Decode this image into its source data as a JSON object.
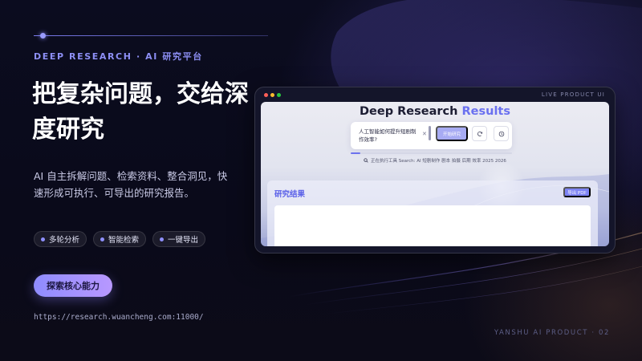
{
  "hero": {
    "eyebrow": "DEEP RESEARCH · AI 研究平台",
    "headline": "把复杂问题，交给深度研究",
    "description": "AI 自主拆解问题、检索资料、整合洞见，快速形成可执行、可导出的研究报告。",
    "chips": [
      "多轮分析",
      "智能检索",
      "一键导出"
    ],
    "cta_label": "探索核心能力",
    "url": "https://research.wuancheng.com:11000/"
  },
  "footer": {
    "text": "YANSHU AI PRODUCT · 02"
  },
  "window": {
    "tag": "LIVE PRODUCT UI",
    "app": {
      "title_main": "Deep Research",
      "title_accent": "Results",
      "query": "人工智能如何提升短剧制作效率?",
      "start_label": "开始研究",
      "progress": 0.06,
      "status": "正在执行工具 Search: AI 短剧制作 剧本 拍摄 后期 效率 2025 2026",
      "results_title": "研究结果",
      "export_label": "导出 PDF"
    }
  },
  "icons": {
    "clear": "close-icon",
    "refresh": "refresh-icon",
    "history": "clock-icon",
    "status": "search-icon"
  },
  "colors": {
    "accent": "#8d8ff5",
    "background": "#0a0b1c",
    "cta": "#a594ff",
    "app_accent": "#6a70f0"
  }
}
